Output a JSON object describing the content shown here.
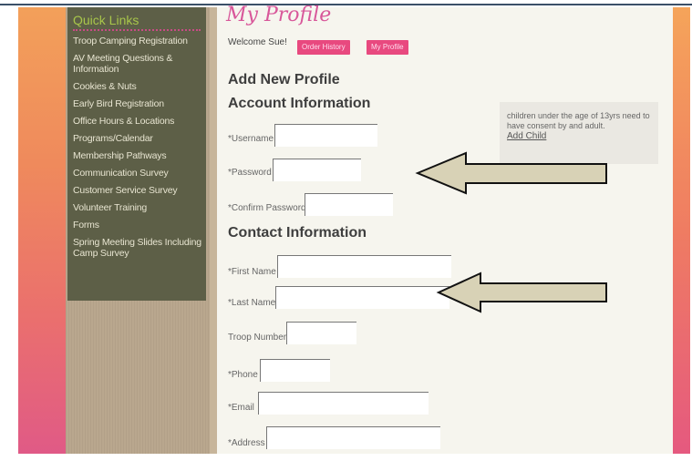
{
  "sidebar": {
    "title": "Quick Links",
    "items": [
      {
        "label": "Troop Camping Registration"
      },
      {
        "label": "AV Meeting Questions & Information"
      },
      {
        "label": "Cookies & Nuts"
      },
      {
        "label": "Early Bird Registration"
      },
      {
        "label": "Office Hours & Locations"
      },
      {
        "label": "Programs/Calendar"
      },
      {
        "label": "Membership Pathways"
      },
      {
        "label": "Communication Survey"
      },
      {
        "label": "Customer Service Survey"
      },
      {
        "label": "Volunteer Training"
      },
      {
        "label": "Forms"
      },
      {
        "label": "Spring Meeting Slides Including Camp Survey"
      }
    ]
  },
  "main": {
    "page_title": "My Profile",
    "welcome": "Welcome Sue!",
    "buttons": {
      "order_history": "Order History",
      "my_profile": "My Profile"
    },
    "add_new_profile": "Add New Profile",
    "account_heading": "Account Information",
    "contact_heading": "Contact Information",
    "labels": {
      "username": "*Username",
      "password": "*Password",
      "confirm_password": "*Confirm Password",
      "first_name": "*First Name",
      "last_name": "*Last Name",
      "troop_number": "Troop Number",
      "phone": "*Phone",
      "email": "*Email",
      "address": "*Address"
    },
    "info_box": {
      "text": "children under the age of 13yrs need to have consent by and adult.",
      "link": "Add Child"
    }
  },
  "colors": {
    "accent_pink": "#e8497f",
    "sidebar_bg": "#5d5f47",
    "title_pink": "#d8579a",
    "arrow_fill": "#d8d2b6"
  },
  "icons": [
    "left-arrow-icon",
    "left-arrow-icon"
  ]
}
